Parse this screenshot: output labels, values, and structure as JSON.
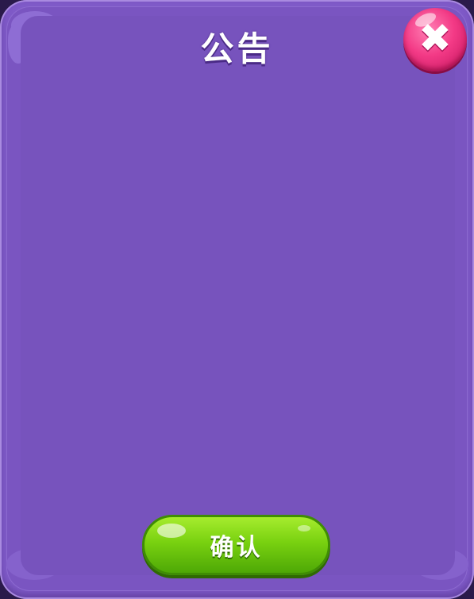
{
  "dialog": {
    "title": "公告",
    "confirm_label": "确认"
  },
  "icons": {
    "close": "close-icon"
  },
  "colors": {
    "panel": "#7753bd",
    "close_button": "#f33a86",
    "confirm_button": "#79d110"
  }
}
